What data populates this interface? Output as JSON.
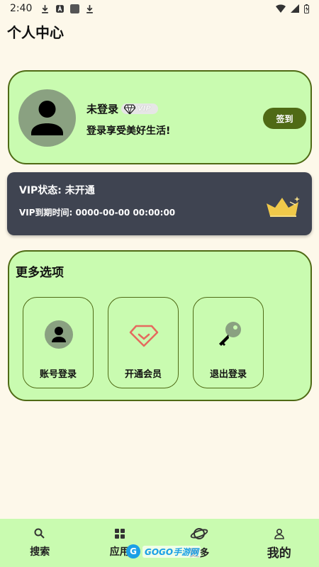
{
  "status_bar": {
    "time": "2:40"
  },
  "page": {
    "title": "个人中心"
  },
  "profile": {
    "username": "未登录",
    "vip_badge": "VIP",
    "subtitle": "登录享受美好生活!",
    "checkin_label": "签到"
  },
  "vip_card": {
    "status": "VIP状态: 未开通",
    "expire": "VIP到期时间: 0000-00-00 00:00:00"
  },
  "options": {
    "title": "更多选项",
    "items": [
      {
        "label": "账号登录",
        "icon": "user-icon"
      },
      {
        "label": "开通会员",
        "icon": "diamond-icon"
      },
      {
        "label": "退出登录",
        "icon": "key-icon"
      }
    ]
  },
  "bottom_nav": {
    "items": [
      {
        "label": "搜索",
        "icon": "search-icon"
      },
      {
        "label": "应用",
        "icon": "grid-icon"
      },
      {
        "label": "更多",
        "icon": "planet-icon"
      },
      {
        "label": "我的",
        "icon": "person-icon",
        "active": true
      }
    ]
  },
  "watermark": {
    "text": "GOGO手游网"
  },
  "colors": {
    "background": "#fdf8ea",
    "card_green": "#c9fbb0",
    "accent_dark_green": "#4f6a15",
    "vip_card_dark": "#3f4451",
    "crown_gold": "#f0c94a"
  }
}
